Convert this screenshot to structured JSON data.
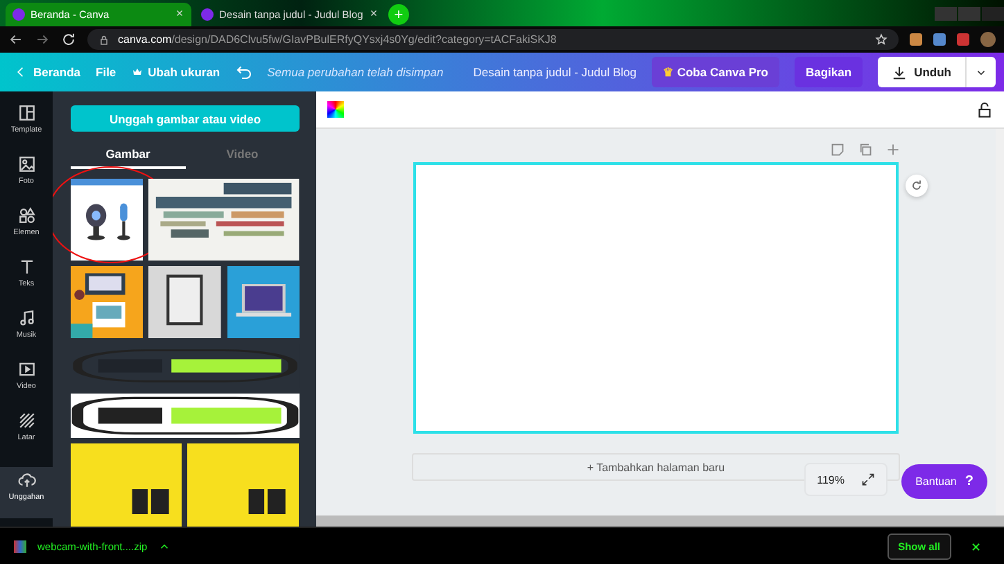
{
  "browser": {
    "tabs": [
      {
        "title": "Beranda - Canva",
        "selected": true
      },
      {
        "title": "Desain tanpa judul - Judul Blog",
        "selected": false
      }
    ],
    "new_tab": "+",
    "url_host": "canva.com",
    "url_path": "/design/DAD6Clvu5fw/GIavPBulERfyQYsxj4s0Yg/edit?category=tACFakiSKJ8"
  },
  "toolbar": {
    "back": "Beranda",
    "file": "File",
    "resize": "Ubah ukuran",
    "save_status": "Semua perubahan telah disimpan",
    "doc_title": "Desain tanpa judul - Judul Blog",
    "pro_icon": "♛",
    "pro": "Coba Canva Pro",
    "share": "Bagikan",
    "download": "Unduh"
  },
  "sidebar": {
    "items": [
      {
        "label": "Template",
        "selected": false
      },
      {
        "label": "Foto",
        "selected": false
      },
      {
        "label": "Elemen",
        "selected": false
      },
      {
        "label": "Teks",
        "selected": false
      },
      {
        "label": "Musik",
        "selected": false
      },
      {
        "label": "Video",
        "selected": false
      },
      {
        "label": "Latar",
        "selected": false
      },
      {
        "label": "Unggahan",
        "selected": true
      }
    ]
  },
  "panel": {
    "upload_button": "Unggah gambar atau video",
    "tabs": [
      {
        "label": "Gambar",
        "selected": true
      },
      {
        "label": "Video",
        "selected": false
      }
    ],
    "media": [
      {
        "kind": "picture",
        "circled": true
      },
      {
        "kind": "picture",
        "circled": false
      },
      {
        "kind": "picture",
        "circled": false
      },
      {
        "kind": "picture",
        "circled": false
      },
      {
        "kind": "picture",
        "circled": false
      },
      {
        "kind": "picture",
        "circled": false
      },
      {
        "kind": "picture",
        "circled": false
      },
      {
        "kind": "picture",
        "circled": false
      },
      {
        "kind": "picture",
        "circled": false
      }
    ]
  },
  "canvas": {
    "add_page": "+ Tambahkan halaman baru",
    "zoom": "119%",
    "help": "Bantuan",
    "help_icon": "?"
  },
  "downloads": {
    "file": "webcam-with-front....zip",
    "show_all": "Show all",
    "close": "✕"
  }
}
